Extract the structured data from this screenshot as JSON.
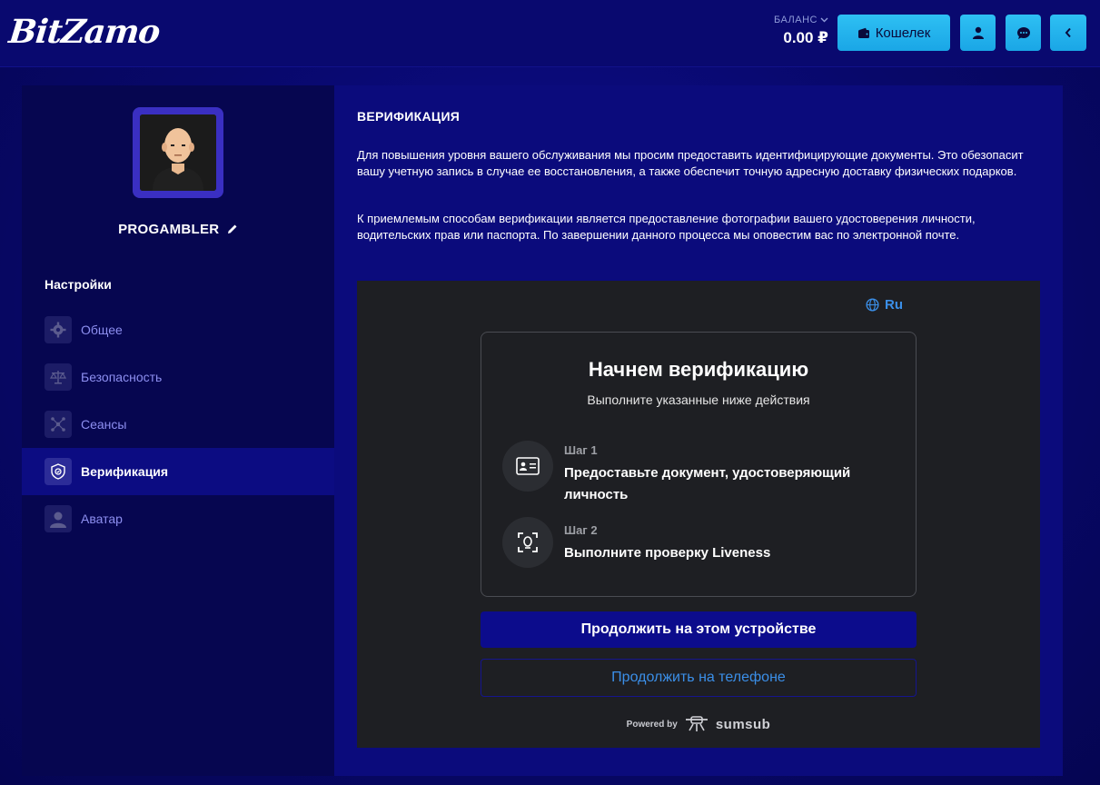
{
  "header": {
    "logo": "BitZamo",
    "balance_label": "БАЛАНС",
    "balance_value": "0.00 ₽",
    "wallet_label": "Кошелек",
    "accent": "#1fb0ee"
  },
  "sidebar": {
    "username": "PROGAMBLER",
    "settings_title": "Настройки",
    "items": [
      {
        "label": "Общее",
        "icon": "gear-icon"
      },
      {
        "label": "Безопасность",
        "icon": "scales-icon"
      },
      {
        "label": "Сеансы",
        "icon": "network-icon"
      },
      {
        "label": "Верификация",
        "icon": "shield-icon",
        "active": true
      },
      {
        "label": "Аватар",
        "icon": "avatar-icon"
      }
    ]
  },
  "main": {
    "title": "ВЕРИФИКАЦИЯ",
    "paragraph1": "Для повышения уровня вашего обслуживания мы просим предоставить идентифицирующие документы. Это обезопасит вашу учетную запись в случае ее восстановления, а также обеспечит точную адресную доставку физических подарков.",
    "paragraph2": "К приемлемым способам верификации является предоставление фотографии вашего удостоверения личности, водительских прав или паспорта. По завершении данного процесса мы оповестим вас по электронной почте."
  },
  "sumsub": {
    "language": "Ru",
    "title": "Начнем верификацию",
    "subtitle": "Выполните указанные ниже действия",
    "steps": [
      {
        "label": "Шаг 1",
        "text": "Предоставьте документ, удостоверяющий личность"
      },
      {
        "label": "Шаг 2",
        "text": "Выполните проверку Liveness"
      }
    ],
    "primary_button": "Продолжить на этом устройстве",
    "secondary_button": "Продолжить на телефоне",
    "powered_by": "Powered by",
    "brand": "sumsub"
  }
}
